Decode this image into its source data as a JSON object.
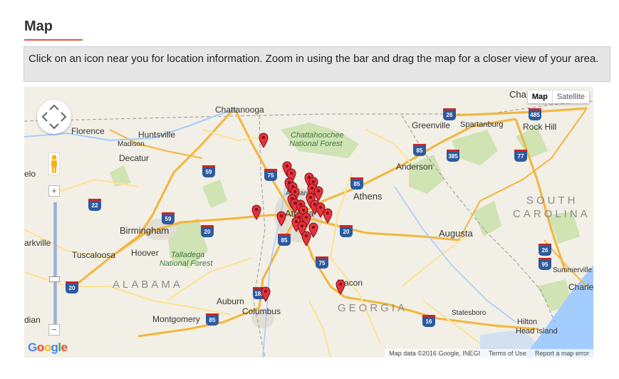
{
  "header": {
    "title": "Map",
    "instructions": "Click on an icon near you for location information. Zoom in using the bar and drag the map for a closer view of your area."
  },
  "map": {
    "type_control": {
      "map_label": "Map",
      "satellite_label": "Satellite"
    },
    "zoom": {
      "in_label": "+",
      "out_label": "−"
    },
    "attribution": {
      "data": "Map data ©2016 Google, INEGI",
      "terms": "Terms of Use",
      "report": "Report a map error"
    },
    "logo": [
      "G",
      "o",
      "o",
      "g",
      "l",
      "e"
    ],
    "states": {
      "alabama": "ALABAMA",
      "georgia": "GEORGIA",
      "south": "SOUTH",
      "carolina": "CAROLINA"
    },
    "forests": {
      "chattahoochee_1": "Chattahoochee",
      "chattahoochee_2": "National Forest",
      "talladega_1": "Talladega",
      "talladega_2": "National Forest"
    },
    "cities": {
      "chattanooga": "Chattanooga",
      "florence": "Florence",
      "huntsville": "Huntsville",
      "madison": "Madison",
      "decatur": "Decatur",
      "elo": "elo",
      "birmingham": "Birmingham",
      "hoover": "Hoover",
      "tuscaloosa": "Tuscaloosa",
      "arkville": "arkville",
      "alpharetta": "Alpharetta",
      "atlanta": "Atlanta",
      "athens": "Athens",
      "augusta": "Augusta",
      "macon": "Macon",
      "columbus": "Columbus",
      "auburn": "Auburn",
      "montgomery": "Montgomery",
      "dian": "dian",
      "statesboro": "Statesboro",
      "greenville": "Greenville",
      "spartanburg": "Spartanburg",
      "rock_hill": "Rock Hill",
      "anderson": "Anderson",
      "summerville": "Summerville",
      "charle": "Charle",
      "hilton_head_1": "Hilton",
      "hilton_head_2": "Head Island",
      "cha": "Cha"
    },
    "highways": {
      "i75_n": "75",
      "i59_n": "59",
      "i85_ne": "85",
      "i22": "22",
      "i59_s": "59",
      "i20_w": "20",
      "i20_e": "20",
      "i85_atl": "85",
      "i75_s": "75",
      "i185": "185",
      "i85_s": "85",
      "i20_sw": "20",
      "i16": "16",
      "i26_n": "26",
      "i85_sc": "85",
      "i385": "385",
      "i485": "485",
      "i77": "77",
      "i26_s": "26",
      "i95": "95"
    },
    "location_marker_count": 28
  }
}
